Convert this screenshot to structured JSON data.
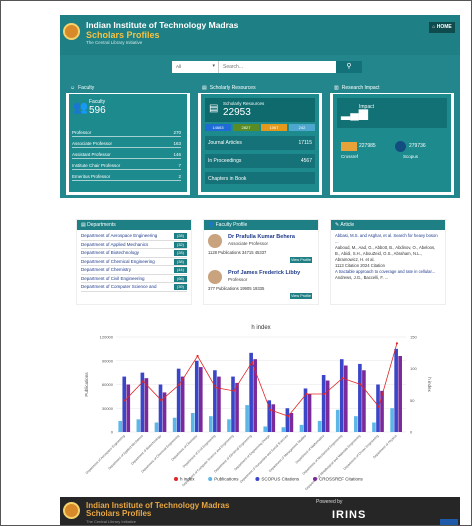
{
  "header": {
    "line1": "Indian Institute of Technology Madras",
    "line2": "Scholars Profiles",
    "line3": "The Central Library Initiative",
    "home": "HOME"
  },
  "search": {
    "select": "All",
    "placeholder": "Search..."
  },
  "faculty": {
    "title": "Faculty",
    "label": "Faculty",
    "count": "596",
    "rows": [
      [
        "Professor",
        "270"
      ],
      [
        "Associate Professor",
        "163"
      ],
      [
        "Assistant Professor",
        "146"
      ],
      [
        "Institute Chair Professor",
        "7"
      ],
      [
        "Emeritus Professor",
        "2"
      ]
    ]
  },
  "resources": {
    "title": "Scholarly Resources",
    "label": "Scholarly Resources",
    "count": "22953",
    "chips": [
      {
        "v": "14663",
        "c": "#1e6bd6"
      },
      {
        "v": "2827",
        "c": "#5a8c25"
      },
      {
        "v": "1067",
        "c": "#e39a1c"
      },
      {
        "v": "242",
        "c": "#4da7cf"
      }
    ],
    "rows": [
      [
        "Journal Articles",
        "17115"
      ],
      [
        "In Proceedings",
        "4567"
      ],
      [
        "Chapters in Book",
        ""
      ]
    ]
  },
  "impact": {
    "title": "Research Impact",
    "label": "Impact",
    "crossref": "227985",
    "crossref_lbl": "Crossref",
    "scopus": "279736",
    "scopus_lbl": "Scopus"
  },
  "departments": {
    "title": "Departments",
    "items": [
      [
        "Department of Aerospace Engineering",
        "(28)"
      ],
      [
        "Department of Applied Mechanics",
        "(32)"
      ],
      [
        "Department of Biotechnology",
        "(28)"
      ],
      [
        "Department of Chemical Engineering",
        "(38)"
      ],
      [
        "Department of Chemistry",
        "(44)"
      ],
      [
        "Department of Civil Engineering",
        "(66)"
      ],
      [
        "Department of Computer Science and",
        "(39)"
      ]
    ]
  },
  "profile": {
    "title": "Faculty Profile",
    "p1": {
      "name": "Dr Prafulla Kumar Behera",
      "role": "Associate Professor",
      "stats": "1128 Publications  34715  45337",
      "btn": "View Profile"
    },
    "p2": {
      "name": "Prof James Frederick Libby",
      "role": "Professor",
      "stats": "377 Publications  19905  19335",
      "btn": "View Profile"
    }
  },
  "article": {
    "title": "Article",
    "a1": "Abbasi, M.S. and Asghar, et al. Search for heavy boson ...",
    "a1_auth": "Aaboud, M., Aad, G., Abbott, B., Abdinov, O., Abeloos, B., Abidi, S.H., AbouZeid, O.S., Abraham, N.L., Abramowicz, H. et al.",
    "a1_cit": "1113 Citation  2024 Citation",
    "a2": "A tractable approach to coverage and rate in cellular...",
    "a2_auth": "Andrews, J.G., Baccelli, F. ..."
  },
  "chart_data": {
    "type": "bar",
    "title": "h index",
    "ylabel": "Publications",
    "y2label": "h index",
    "categories": [
      "Department of Aerospace Engineering",
      "Department of Applied Mechanics",
      "Department of Biotechnology",
      "Department of Chemical Engineering",
      "Department of Chemistry",
      "Department of Civil Engineering",
      "Department of Computer Science and Engineering",
      "Department of Electrical Engineering",
      "Department of Engineering Design",
      "Department of Humanities and Social Sciences",
      "Department of Management Studies",
      "Department of Mathematics",
      "Department of Mechanical Engineering",
      "Department of Metallurgical and Materials Engineering",
      "Department of Ocean Engineering",
      "Department of Physics"
    ],
    "ylim": [
      0,
      120000
    ],
    "yticks": [
      "0",
      "30000",
      "60000",
      "90000",
      "120000"
    ],
    "y2ticks": [
      "0",
      "50",
      "100",
      "150"
    ],
    "series": [
      {
        "name": "h index",
        "color": "#e12626",
        "values": [
          50,
          80,
          50,
          75,
          120,
          70,
          65,
          110,
          35,
          25,
          60,
          60,
          85,
          75,
          40,
          140
        ]
      },
      {
        "name": "Publications",
        "color": "#5cb7e8",
        "values": [
          14000,
          16000,
          12000,
          18000,
          24000,
          20000,
          16000,
          34000,
          7000,
          6000,
          9000,
          14000,
          28000,
          20000,
          12000,
          30000
        ]
      },
      {
        "name": "SCOPUS Citations",
        "color": "#3b45c8",
        "values": [
          70000,
          75000,
          60000,
          80000,
          90000,
          78000,
          70000,
          100000,
          40000,
          30000,
          55000,
          72000,
          92000,
          86000,
          60000,
          105000
        ]
      },
      {
        "name": "CROSSREF Citations",
        "color": "#7a2a9a",
        "values": [
          60000,
          68000,
          50000,
          70000,
          82000,
          70000,
          62000,
          92000,
          35000,
          24000,
          48000,
          65000,
          84000,
          78000,
          52000,
          96000
        ]
      }
    ]
  },
  "footer": {
    "line1": "Indian Institute of Technology Madras",
    "line2": "Scholars Profiles",
    "line3": "The Central Library Initiative",
    "powered": "Powered by",
    "irins": "IRINS"
  }
}
